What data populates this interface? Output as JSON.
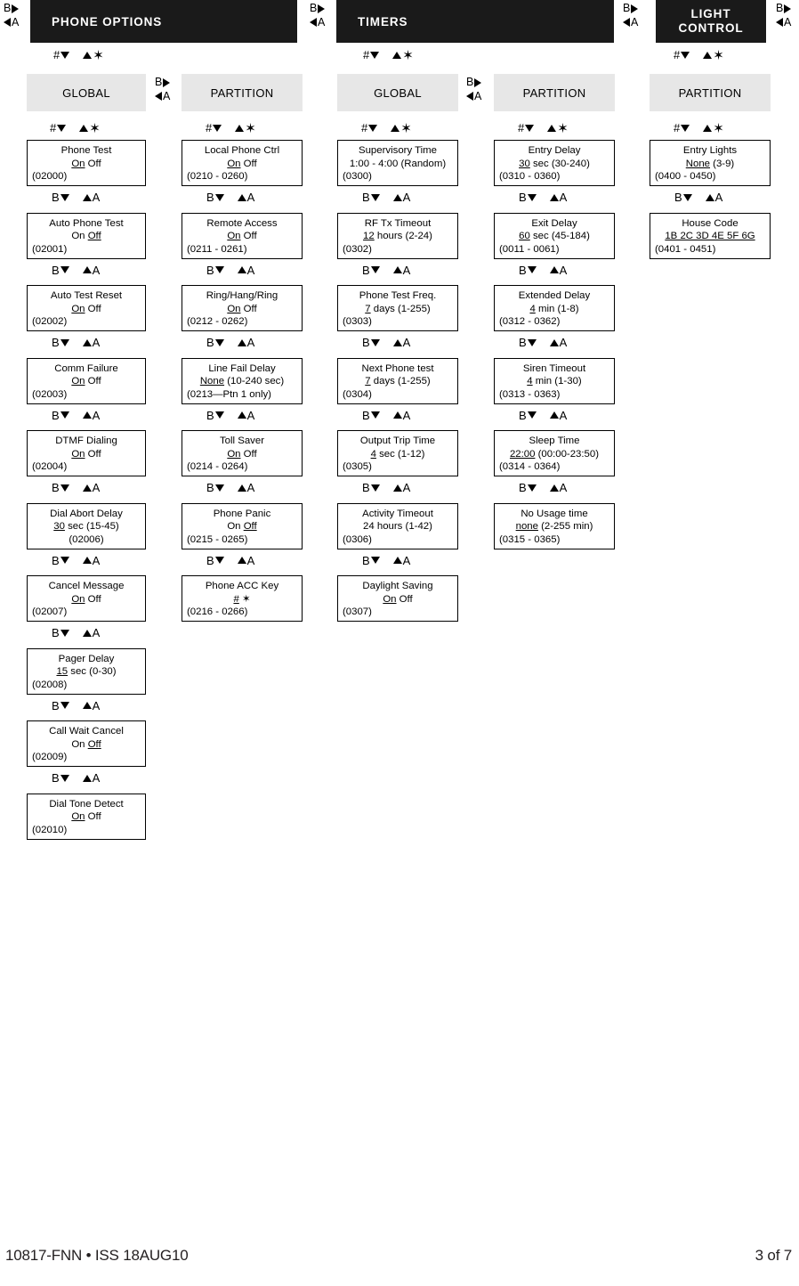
{
  "page": {
    "footer_left": "10817-FNN • ISS 18AUG10",
    "footer_right": "3 of 7"
  },
  "nav": {
    "b": "B",
    "a": "A",
    "hash": "#",
    "star": "✶"
  },
  "sections": [
    {
      "id": "phone-options",
      "title": "PHONE OPTIONS",
      "columns": [
        {
          "id": "phone-global",
          "label": "GLOBAL"
        },
        {
          "id": "phone-partition",
          "label": "PARTITION"
        }
      ]
    },
    {
      "id": "timers",
      "title": "TIMERS",
      "columns": [
        {
          "id": "timers-global",
          "label": "GLOBAL"
        },
        {
          "id": "timers-partition",
          "label": "PARTITION"
        }
      ]
    },
    {
      "id": "light-control",
      "title_line1": "LIGHT",
      "title_line2": "CONTROL",
      "columns": [
        {
          "id": "light-partition",
          "label": "PARTITION"
        }
      ]
    }
  ],
  "phone_global": [
    {
      "title": "Phone Test",
      "value_pre": "",
      "value_u": "On",
      "value_post": " Off",
      "code": "(02000)"
    },
    {
      "title": "Auto Phone Test",
      "value_pre": "On ",
      "value_u": "Off",
      "value_post": "",
      "code": "(02001)"
    },
    {
      "title": "Auto Test Reset",
      "value_pre": "",
      "value_u": "On",
      "value_post": " Off",
      "code": "(02002)"
    },
    {
      "title": "Comm Failure",
      "value_pre": "",
      "value_u": "On",
      "value_post": " Off",
      "code": "(02003)"
    },
    {
      "title": "DTMF Dialing",
      "value_pre": "",
      "value_u": "On",
      "value_post": " Off",
      "code": "(02004)"
    },
    {
      "title": "Dial Abort Delay",
      "value_pre": "",
      "value_u": "30",
      "value_post": " sec (15-45)",
      "code": "(02006)",
      "code_center": true
    },
    {
      "title": "Cancel Message",
      "value_pre": "",
      "value_u": "On",
      "value_post": " Off",
      "code": "(02007)"
    },
    {
      "title": "Pager Delay",
      "value_pre": "",
      "value_u": "15",
      "value_post": " sec (0-30)",
      "code": "(02008)"
    },
    {
      "title": "Call Wait Cancel",
      "value_pre": "On ",
      "value_u": "Off",
      "value_post": "",
      "code": "(02009)"
    },
    {
      "title": "Dial Tone Detect",
      "value_pre": "",
      "value_u": "On",
      "value_post": " Off",
      "code": "(02010)"
    }
  ],
  "phone_partition": [
    {
      "title": "Local Phone Ctrl",
      "value_pre": "",
      "value_u": "On",
      "value_post": " Off",
      "code": "(0210 - 0260)"
    },
    {
      "title": "Remote Access",
      "value_pre": "",
      "value_u": "On",
      "value_post": " Off",
      "code": "(0211 - 0261)"
    },
    {
      "title": "Ring/Hang/Ring",
      "value_pre": "",
      "value_u": "On",
      "value_post": " Off",
      "code": "(0212 - 0262)"
    },
    {
      "title": "Line Fail Delay",
      "value_pre": "",
      "value_u": "None",
      "value_post": " (10-240 sec)",
      "code": "(0213—Ptn 1 only)"
    },
    {
      "title": "Toll Saver",
      "value_pre": "",
      "value_u": "On",
      "value_post": " Off",
      "code": "(0214 - 0264)"
    },
    {
      "title": "Phone Panic",
      "value_pre": "On ",
      "value_u": "Off",
      "value_post": "",
      "code": "(0215 - 0265)"
    },
    {
      "title": "Phone ACC Key",
      "value_pre": "",
      "value_u": "#",
      "value_post": "   ✶",
      "code": "(0216 - 0266)"
    }
  ],
  "timers_global": [
    {
      "title": "Supervisory Time",
      "value_pre": "1:00 - 4:00 (Random)",
      "value_u": "",
      "value_post": "",
      "code": "(0300)"
    },
    {
      "title": "RF Tx Timeout",
      "value_pre": "",
      "value_u": "12",
      "value_post": " hours (2-24)",
      "code": "(0302)"
    },
    {
      "title": "Phone Test Freq.",
      "value_pre": "",
      "value_u": "7",
      "value_post": " days (1-255)",
      "code": "(0303)"
    },
    {
      "title": "Next Phone test",
      "value_pre": "",
      "value_u": "7",
      "value_post": " days (1-255)",
      "code": "(0304)"
    },
    {
      "title": "Output Trip Time",
      "value_pre": "",
      "value_u": "4",
      "value_post": " sec (1-12)",
      "code": "(0305)"
    },
    {
      "title": "Activity Timeout",
      "value_pre": "24 hours (1-42)",
      "value_u": "",
      "value_post": "",
      "code": "(0306)"
    },
    {
      "title": "Daylight Saving",
      "value_pre": "",
      "value_u": "On",
      "value_post": " Off",
      "code": "(0307)"
    }
  ],
  "timers_partition": [
    {
      "title": "Entry Delay",
      "value_pre": "",
      "value_u": "30",
      "value_post": " sec (30-240)",
      "code": "(0310 - 0360)"
    },
    {
      "title": "Exit Delay",
      "value_pre": "",
      "value_u": "60",
      "value_post": " sec (45-184)",
      "code": "(0011 - 0061)"
    },
    {
      "title": "Extended Delay",
      "value_pre": "",
      "value_u": "4",
      "value_post": " min (1-8)",
      "code": "(0312 - 0362)"
    },
    {
      "title": "Siren Timeout",
      "value_pre": "",
      "value_u": "4",
      "value_post": " min (1-30)",
      "code": "(0313 - 0363)"
    },
    {
      "title": "Sleep Time",
      "value_pre": "",
      "value_u": "22:00",
      "value_post": " (00:00-23:50)",
      "code": "(0314 - 0364)"
    },
    {
      "title": "No Usage time",
      "value_pre": "",
      "value_u": "none",
      "value_post": " (2-255 min)",
      "code": "(0315 - 0365)"
    }
  ],
  "light_partition": [
    {
      "title": "Entry Lights",
      "value_pre": "",
      "value_u": "None",
      "value_post": " (3-9)",
      "code": "(0400 - 0450)"
    },
    {
      "title": "House Code",
      "value_pre": "",
      "value_u": "1B 2C 3D 4E 5F 6G",
      "value_post": "",
      "code": "(0401 - 0451)"
    }
  ]
}
